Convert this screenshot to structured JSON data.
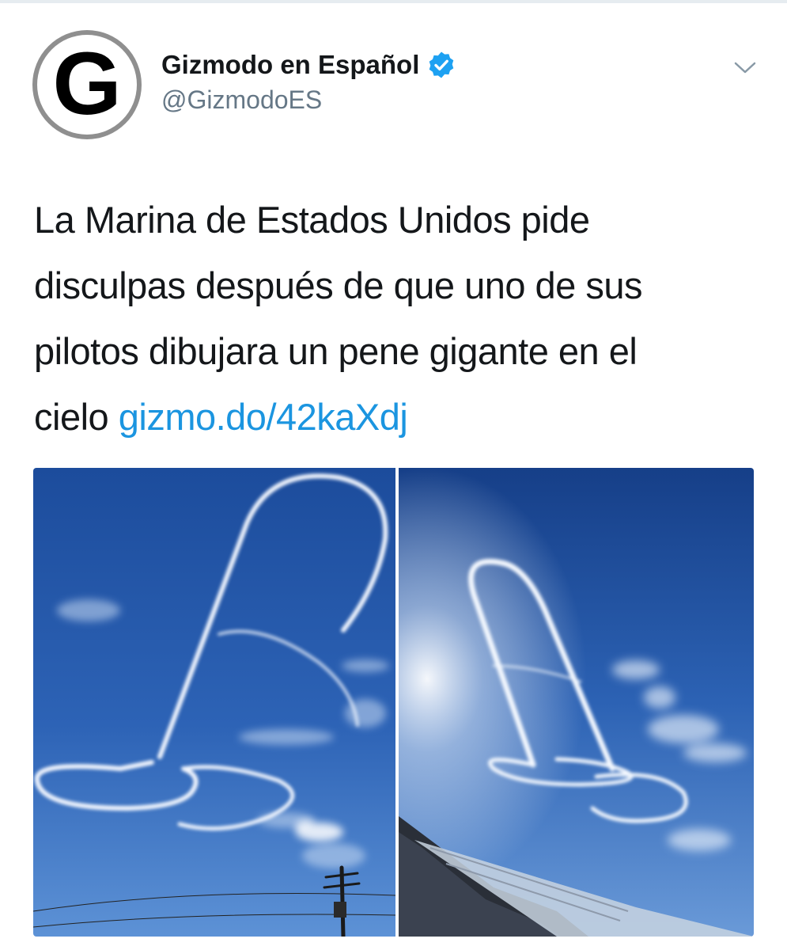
{
  "tweet": {
    "author": {
      "display_name": "Gizmodo en Español",
      "handle": "@GizmodoES",
      "verified": true,
      "avatar_letter": "G"
    },
    "text_lines": [
      "La Marina de Estados Unidos pide",
      "disculpas después de que uno de sus",
      "pilotos dibujara un pene gigante en el",
      "cielo "
    ],
    "link": "gizmo.do/42kaXdj",
    "media_count": 2
  },
  "icons": {
    "verified": "verified-badge-icon",
    "menu": "chevron-down-icon"
  },
  "colors": {
    "text": "#14171a",
    "secondary_text": "#657786",
    "link": "#1b95e0",
    "verified_badge": "#1da1f2",
    "sky_top": "#1d4fa0",
    "sky_bottom": "#5a8ed4"
  }
}
